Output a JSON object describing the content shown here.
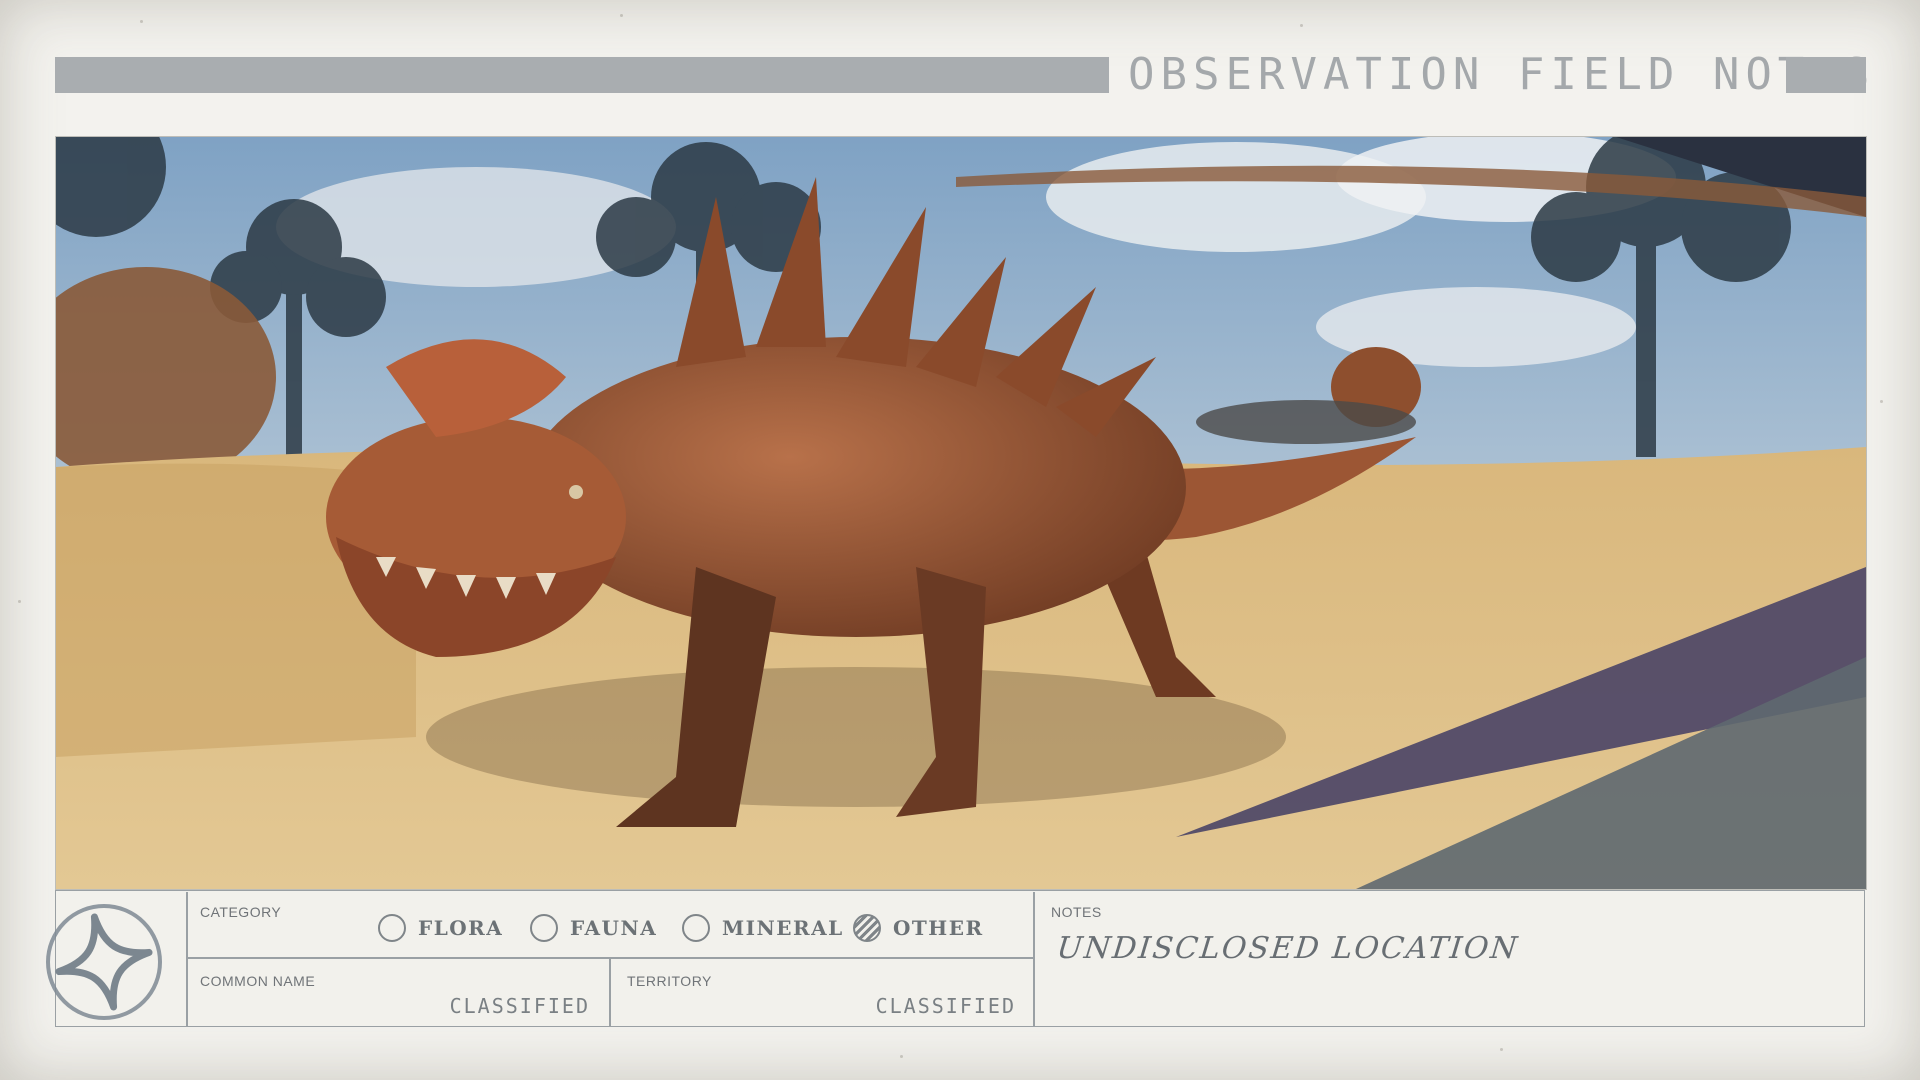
{
  "header": {
    "title": "OBSERVATION FIELD NOTES"
  },
  "photo": {
    "subject": "creature-photo"
  },
  "category": {
    "label": "CATEGORY",
    "options": [
      {
        "label": "FLORA",
        "selected": false
      },
      {
        "label": "FAUNA",
        "selected": false
      },
      {
        "label": "MINERAL",
        "selected": false
      },
      {
        "label": "OTHER",
        "selected": true
      }
    ]
  },
  "common_name": {
    "label": "COMMON NAME",
    "value": "CLASSIFIED"
  },
  "territory": {
    "label": "TERRITORY",
    "value": "CLASSIFIED"
  },
  "notes": {
    "label": "NOTES",
    "value": "UNDISCLOSED LOCATION"
  },
  "colors": {
    "paper": "#f3f2ee",
    "ink": "#7f8589",
    "header_bar": "#a9adb0"
  },
  "icons": {
    "emblem": "four-point-star-seal-icon"
  }
}
